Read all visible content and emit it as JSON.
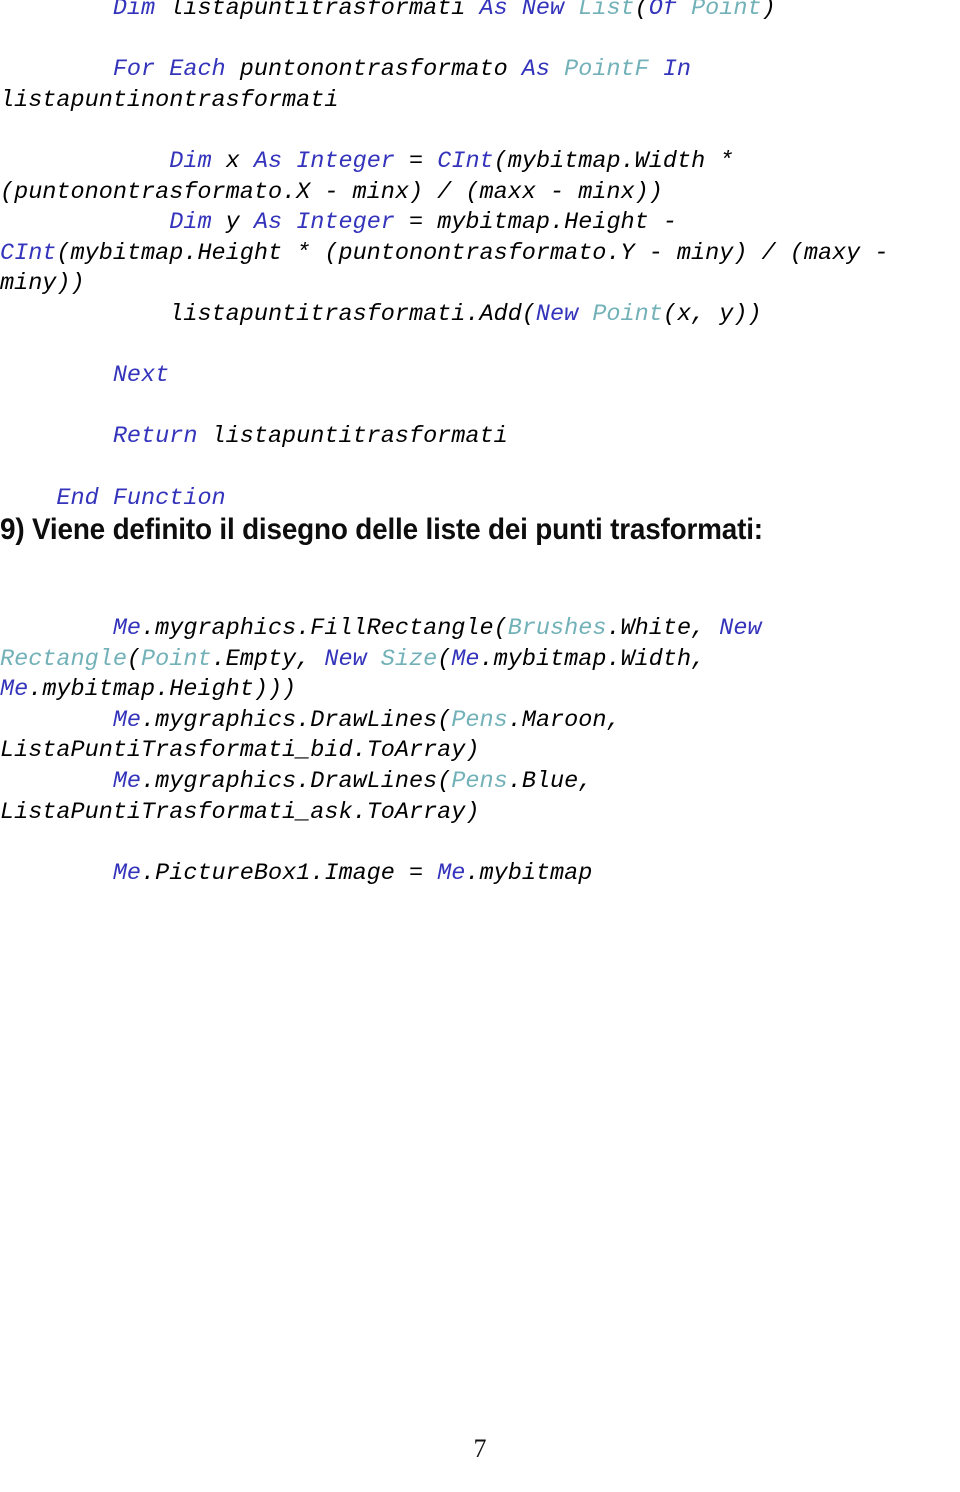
{
  "document": {
    "page_number": "7",
    "language": "vb.net",
    "colors": {
      "keyword": "#3333bb",
      "type": "#72b1b8",
      "plain": "#000000",
      "heading": "#0d0d0d",
      "background": "#ffffff"
    }
  },
  "code_upper": {
    "lines": [
      [
        {
          "t": "        ",
          "c": "pln"
        },
        {
          "t": "Dim ",
          "c": "kw"
        },
        {
          "t": "listapuntitrasformati ",
          "c": "pln"
        },
        {
          "t": "As New ",
          "c": "kw"
        },
        {
          "t": "List",
          "c": "typ"
        },
        {
          "t": "(",
          "c": "pln"
        },
        {
          "t": "Of ",
          "c": "kw"
        },
        {
          "t": "Point",
          "c": "typ"
        },
        {
          "t": ")",
          "c": "pln"
        }
      ],
      [],
      [
        {
          "t": "        ",
          "c": "pln"
        },
        {
          "t": "For Each ",
          "c": "kw"
        },
        {
          "t": "puntonontrasformato ",
          "c": "pln"
        },
        {
          "t": "As ",
          "c": "kw"
        },
        {
          "t": "PointF ",
          "c": "typ"
        },
        {
          "t": "In ",
          "c": "kw"
        },
        {
          "t": "listapuntinontrasformati",
          "c": "pln"
        }
      ],
      [],
      [
        {
          "t": "            ",
          "c": "pln"
        },
        {
          "t": "Dim ",
          "c": "kw"
        },
        {
          "t": "x ",
          "c": "pln"
        },
        {
          "t": "As Integer ",
          "c": "kw"
        },
        {
          "t": "= ",
          "c": "pln"
        },
        {
          "t": "CInt",
          "c": "kw"
        },
        {
          "t": "(mybitmap.Width * (puntonontrasformato.X - minx) / (maxx - minx))",
          "c": "pln"
        }
      ],
      [
        {
          "t": "            ",
          "c": "pln"
        },
        {
          "t": "Dim ",
          "c": "kw"
        },
        {
          "t": "y ",
          "c": "pln"
        },
        {
          "t": "As Integer ",
          "c": "kw"
        },
        {
          "t": "= mybitmap.Height - ",
          "c": "pln"
        },
        {
          "t": "CInt",
          "c": "kw"
        },
        {
          "t": "(mybitmap.Height * (puntonontrasformato.Y - miny) / (maxy - miny))",
          "c": "pln"
        }
      ],
      [
        {
          "t": "            listapuntitrasformati.Add(",
          "c": "pln"
        },
        {
          "t": "New ",
          "c": "kw"
        },
        {
          "t": "Point",
          "c": "typ"
        },
        {
          "t": "(x, y))",
          "c": "pln"
        }
      ],
      [],
      [
        {
          "t": "        ",
          "c": "pln"
        },
        {
          "t": "Next",
          "c": "kw"
        }
      ],
      [],
      [
        {
          "t": "        ",
          "c": "pln"
        },
        {
          "t": "Return ",
          "c": "kw"
        },
        {
          "t": "listapuntitrasformati",
          "c": "pln"
        }
      ],
      [],
      [
        {
          "t": "    ",
          "c": "pln"
        },
        {
          "t": "End Function",
          "c": "kw"
        }
      ]
    ]
  },
  "heading": {
    "text": "9) Viene definito il disegno delle liste dei punti trasformati:"
  },
  "code_lower": {
    "lines": [
      [
        {
          "t": "        ",
          "c": "pln"
        },
        {
          "t": "Me",
          "c": "kw"
        },
        {
          "t": ".mygraphics.FillRectangle(",
          "c": "pln"
        },
        {
          "t": "Brushes",
          "c": "typ"
        },
        {
          "t": ".White, ",
          "c": "pln"
        },
        {
          "t": "New ",
          "c": "kw"
        },
        {
          "t": "Rectangle",
          "c": "typ"
        },
        {
          "t": "(",
          "c": "pln"
        },
        {
          "t": "Point",
          "c": "typ"
        },
        {
          "t": ".Empty, ",
          "c": "pln"
        },
        {
          "t": "New ",
          "c": "kw"
        },
        {
          "t": "Size",
          "c": "typ"
        },
        {
          "t": "(",
          "c": "pln"
        },
        {
          "t": "Me",
          "c": "kw"
        },
        {
          "t": ".mybitmap.Width, ",
          "c": "pln"
        },
        {
          "t": "Me",
          "c": "kw"
        },
        {
          "t": ".mybitmap.Height)))",
          "c": "pln"
        }
      ],
      [
        {
          "t": "        ",
          "c": "pln"
        },
        {
          "t": "Me",
          "c": "kw"
        },
        {
          "t": ".mygraphics.DrawLines(",
          "c": "pln"
        },
        {
          "t": "Pens",
          "c": "typ"
        },
        {
          "t": ".Maroon, ListaPuntiTrasformati_bid.ToArray)",
          "c": "pln"
        }
      ],
      [
        {
          "t": "        ",
          "c": "pln"
        },
        {
          "t": "Me",
          "c": "kw"
        },
        {
          "t": ".mygraphics.DrawLines(",
          "c": "pln"
        },
        {
          "t": "Pens",
          "c": "typ"
        },
        {
          "t": ".Blue, ListaPuntiTrasformati_ask.ToArray)",
          "c": "pln"
        }
      ],
      [],
      [
        {
          "t": "        ",
          "c": "pln"
        },
        {
          "t": "Me",
          "c": "kw"
        },
        {
          "t": ".PictureBox1.Image = ",
          "c": "pln"
        },
        {
          "t": "Me",
          "c": "kw"
        },
        {
          "t": ".mybitmap",
          "c": "pln"
        }
      ]
    ]
  }
}
